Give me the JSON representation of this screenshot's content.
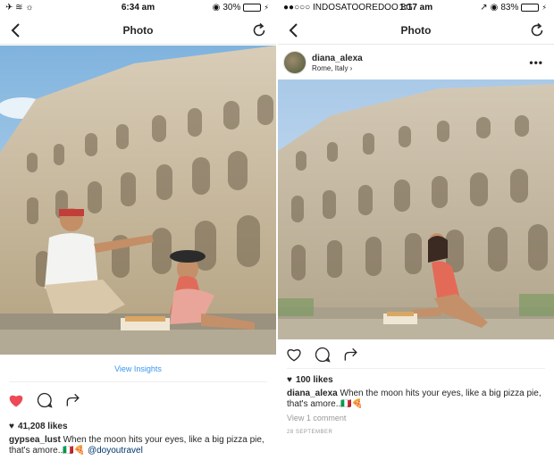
{
  "left": {
    "status": {
      "time": "6:34 am",
      "battery_text": "30%",
      "battery_level": 0.3
    },
    "nav": {
      "title": "Photo"
    },
    "photo_alt": "Couple sitting in front of the Colosseum sharing pizza",
    "view_insights": "View Insights",
    "likes": "41,208 likes",
    "caption": {
      "username": "gypsea_lust",
      "text": "When the moon hits your eyes, like a big pizza pie, that's amore..🇮🇹🍕",
      "mention": "@doyoutravel"
    }
  },
  "right": {
    "status": {
      "carrier": "●●○○○ INDOSATOOREDOO  3G",
      "time": "1:17 am",
      "battery_text": "83%",
      "battery_level": 0.83
    },
    "nav": {
      "title": "Photo"
    },
    "user": {
      "name": "diana_alexa",
      "location": "Rome, Italy ›"
    },
    "more": "•••",
    "photo_alt": "Woman sitting alone in front of the Colosseum eating pizza",
    "likes": "100 likes",
    "caption": {
      "username": "diana_alexa",
      "text": "When the moon hits your eyes, like a big pizza pie, that's amore..🇮🇹🍕"
    },
    "view_comment": "View 1 comment",
    "date": "28 SEPTEMBER"
  },
  "colors": {
    "heart_liked": "#ed4956",
    "link": "#3897f0",
    "battery": "#4cd964"
  }
}
